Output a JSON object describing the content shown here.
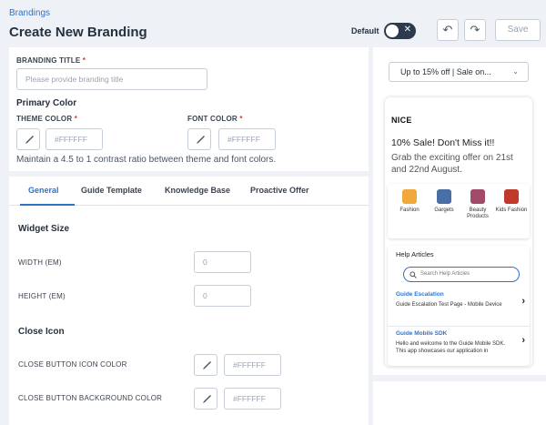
{
  "header": {
    "breadcrumb": "Brandings",
    "title": "Create New Branding",
    "default_label": "Default",
    "toggle_icon": "✕",
    "undo_icon": "↶",
    "redo_icon": "↷",
    "save_label": "Save"
  },
  "branding": {
    "title_label": "BRANDING TITLE",
    "title_placeholder": "Please provide branding title",
    "primary_color_heading": "Primary Color",
    "theme_color_label": "THEME COLOR",
    "theme_color_value": "#FFFFFF",
    "font_color_label": "FONT COLOR",
    "font_color_value": "#FFFFFF",
    "contrast_hint": "Maintain a 4.5 to 1 contrast ratio between theme and font colors.",
    "required_mark": "*"
  },
  "tabs": [
    {
      "label": "General",
      "active": true
    },
    {
      "label": "Guide Template",
      "active": false
    },
    {
      "label": "Knowledge Base",
      "active": false
    },
    {
      "label": "Proactive Offer",
      "active": false
    }
  ],
  "general": {
    "widget_size_heading": "Widget Size",
    "width_label": "WIDTH (EM)",
    "width_value": "0",
    "height_label": "HEIGHT (EM)",
    "height_value": "0",
    "close_icon_heading": "Close Icon",
    "close_icon_color_label": "CLOSE BUTTON ICON COLOR",
    "close_icon_color_value": "#FFFFFF",
    "close_bg_color_label": "CLOSE BUTTON BACKGROUND COLOR",
    "close_bg_color_value": "#FFFFFF"
  },
  "preview": {
    "offer_select": "Up to 15% off | Sale on...",
    "logo": "NICE",
    "headline": "10% Sale! Don't Miss it!!",
    "subtext": "Grab the exciting offer on 21st and 22nd August.",
    "categories": [
      {
        "label": "Fashion",
        "icon": "dress-icon",
        "color": "#f2a93b"
      },
      {
        "label": "Gargets",
        "icon": "laptop-icon",
        "color": "#4a6fa5"
      },
      {
        "label": "Beauty Products",
        "icon": "beauty-icon",
        "color": "#a24a6a"
      },
      {
        "label": "Kids Fashion",
        "icon": "kids-icon",
        "color": "#c0392b"
      }
    ],
    "help_title": "Help Articles",
    "search_placeholder": "Search Help Articles",
    "articles": [
      {
        "title": "Guide Escalation",
        "desc": "Guide Escalation Test Page - Mobile Device"
      },
      {
        "title": "Guide Mobile SDK",
        "desc": "Hello and welcome to the Guide Mobile SDK. This app showcases our application in"
      }
    ]
  },
  "colors": {
    "accent": "#2f73c7",
    "required": "#d6382f",
    "toggle_bg": "#2c3a4e"
  }
}
